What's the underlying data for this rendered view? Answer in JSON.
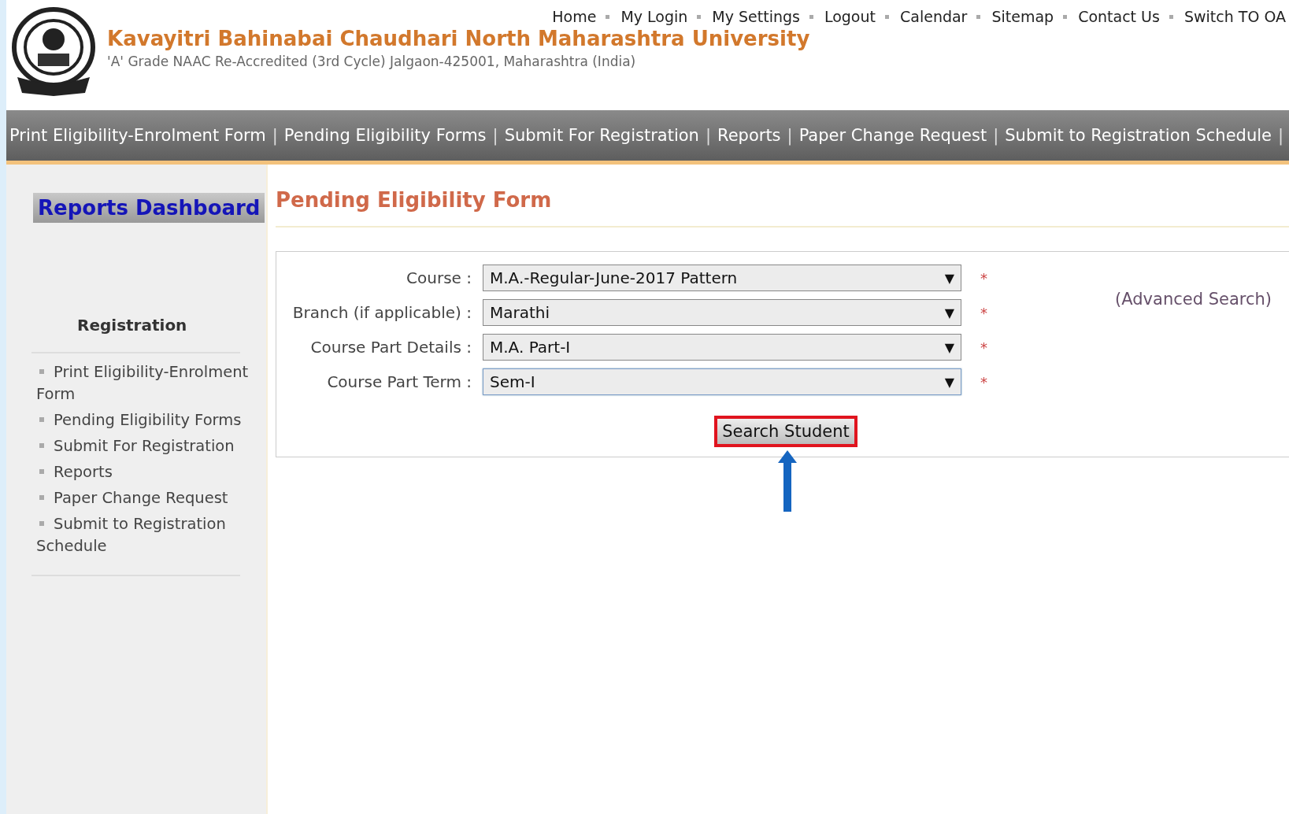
{
  "header": {
    "title": "Kavayitri Bahinabai Chaudhari North Maharashtra University",
    "subtitle": "'A' Grade NAAC Re-Accredited (3rd Cycle) Jalgaon-425001, Maharashtra (India)",
    "top_links": [
      "Home",
      "My Login",
      "My Settings",
      "Logout",
      "Calendar",
      "Sitemap",
      "Contact Us",
      "Switch TO OA"
    ]
  },
  "nav_bar": {
    "separator": "|",
    "items": [
      "Print Eligibility-Enrolment Form",
      "Pending Eligibility Forms",
      "Submit For Registration",
      "Reports",
      "Paper Change Request",
      "Submit to Registration Schedule"
    ]
  },
  "sidebar": {
    "dashboard_button": "Reports Dashboard",
    "section_title": "Registration",
    "items": [
      "Print Eligibility-Enrolment Form",
      "Pending Eligibility Forms",
      "Submit For Registration",
      "Reports",
      "Paper Change Request",
      "Submit to Registration Schedule"
    ]
  },
  "page_title": "Pending Eligibility Form",
  "form": {
    "fields": [
      {
        "label": "Course :",
        "value": "M.A.-Regular-June-2017 Pattern",
        "required_mark": "*",
        "focused": false
      },
      {
        "label": "Branch (if applicable) :",
        "value": "Marathi",
        "required_mark": "*",
        "focused": false
      },
      {
        "label": "Course Part Details :",
        "value": "M.A. Part-I",
        "required_mark": "*",
        "focused": false
      },
      {
        "label": "Course Part Term :",
        "value": "Sem-I",
        "required_mark": "*",
        "focused": true
      }
    ],
    "dropdown_glyph": "▼",
    "advanced_search": "(Advanced Search)",
    "search_button": "Search Student",
    "button_highlighted": true
  }
}
